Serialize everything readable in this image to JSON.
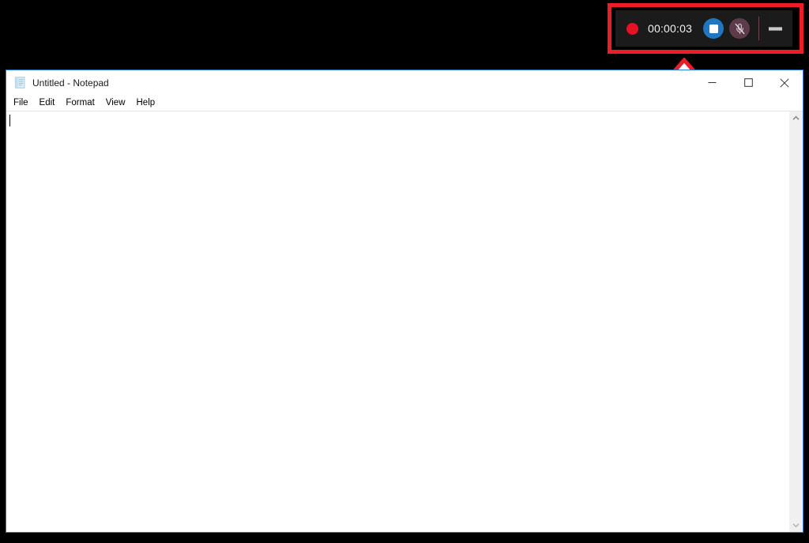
{
  "recorder": {
    "timer": "00:00:03",
    "rec_dot_name": "record-indicator",
    "stop_label": "",
    "mic_label": "",
    "minimize_label": "",
    "accent_blue": "#1f77c4",
    "record_red": "#e81123",
    "bar_background": "#1b1b1b",
    "mic_background": "#5e3b4a"
  },
  "annotation": {
    "color": "#ee1c25",
    "box_label": "",
    "arrow_label": ""
  },
  "notepad": {
    "title": "Untitled - Notepad",
    "menu": [
      {
        "label": "File"
      },
      {
        "label": "Edit"
      },
      {
        "label": "Format"
      },
      {
        "label": "View"
      },
      {
        "label": "Help"
      }
    ],
    "window_controls": {
      "minimize": "",
      "maximize": "",
      "close": ""
    },
    "document_text": "",
    "border_color": "#2a7fd4"
  }
}
